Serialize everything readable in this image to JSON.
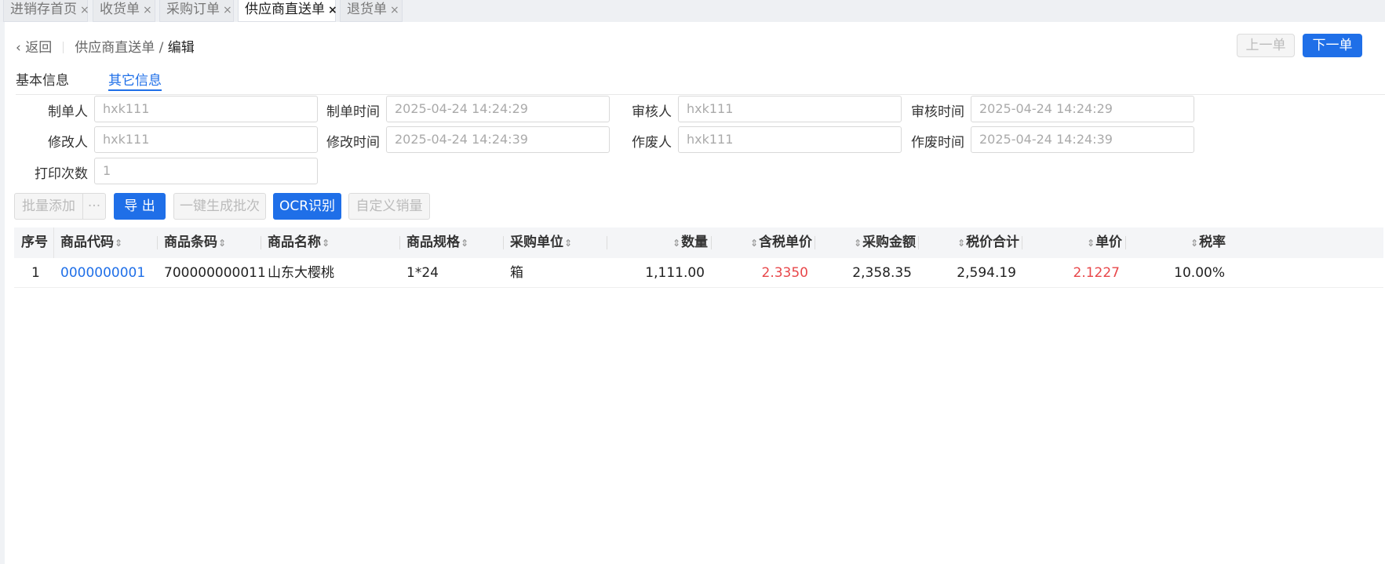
{
  "tabs": [
    {
      "label": "进销存首页",
      "close": "×"
    },
    {
      "label": "收货单",
      "close": "×"
    },
    {
      "label": "采购订单",
      "close": "×"
    },
    {
      "label": "供应商直送单",
      "close": "×"
    },
    {
      "label": "退货单",
      "close": "×"
    }
  ],
  "header": {
    "back_label": "返回",
    "breadcrumb_parent": "供应商直送单",
    "breadcrumb_sep": "/",
    "breadcrumb_current": "编辑",
    "prev_label": "上一单",
    "next_label": "下一单"
  },
  "subtabs": [
    "基本信息",
    "其它信息"
  ],
  "form": {
    "creator_label": "制单人",
    "creator_value": "hxk111",
    "create_time_label": "制单时间",
    "create_time_value": "2025-04-24 14:24:29",
    "auditor_label": "审核人",
    "auditor_value": "hxk111",
    "audit_time_label": "审核时间",
    "audit_time_value": "2025-04-24 14:24:29",
    "modifier_label": "修改人",
    "modifier_value": "hxk111",
    "modify_time_label": "修改时间",
    "modify_time_value": "2025-04-24 14:24:39",
    "voider_label": "作废人",
    "voider_value": "hxk111",
    "void_time_label": "作废时间",
    "void_time_value": "2025-04-24 14:24:39",
    "print_count_label": "打印次数",
    "print_count_value": "1"
  },
  "toolbar": {
    "batch_add": "批量添加",
    "more": "···",
    "export": "导 出",
    "gen_batch": "一键生成批次",
    "ocr": "OCR识别",
    "custom_sales": "自定义销量"
  },
  "table": {
    "columns": [
      "序号",
      "商品代码",
      "商品条码",
      "商品名称",
      "商品规格",
      "采购单位",
      "数量",
      "含税单价",
      "采购金额",
      "税价合计",
      "单价",
      "税率"
    ],
    "sort_glyph": "⇕",
    "rows": [
      {
        "index": "1",
        "code": "0000000001",
        "barcode": "700000000011",
        "name": "山东大樱桃",
        "spec": "1*24",
        "unit": "箱",
        "qty": "1,111.00",
        "tax_price": "2.3350",
        "amount": "2,358.35",
        "tax_total": "2,594.19",
        "price": "2.1227",
        "tax_rate": "10.00%"
      }
    ]
  },
  "colors": {
    "primary": "#1f6fe8",
    "danger": "#e8474a",
    "header_bg": "#f4f5f7"
  }
}
